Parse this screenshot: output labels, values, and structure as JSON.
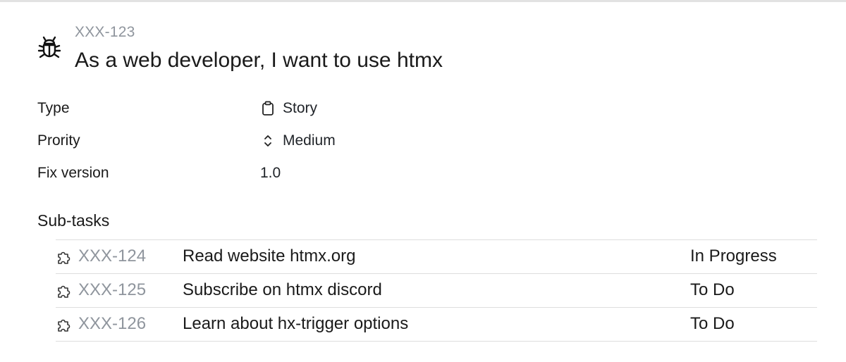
{
  "issue": {
    "icon": "bug-icon",
    "key": "XXX-123",
    "title": "As a web developer, I want to use htmx"
  },
  "properties": [
    {
      "label": "Type",
      "value": "Story",
      "icon": "clipboard-icon"
    },
    {
      "label": "Prority",
      "value": "Medium",
      "icon": "chevron-up-down-icon"
    },
    {
      "label": "Fix version",
      "value": "1.0",
      "icon": ""
    }
  ],
  "subtasks": {
    "heading": "Sub-tasks",
    "icon": "puzzle-icon",
    "rows": [
      {
        "key": "XXX-124",
        "summary": "Read website htmx.org",
        "status": "In Progress"
      },
      {
        "key": "XXX-125",
        "summary": "Subscribe on htmx discord",
        "status": "To Do"
      },
      {
        "key": "XXX-126",
        "summary": "Learn about hx-trigger options",
        "status": "To Do"
      }
    ]
  },
  "colors": {
    "muted": "#8f959d",
    "text": "#1a1a1a",
    "divider": "#dedede"
  }
}
